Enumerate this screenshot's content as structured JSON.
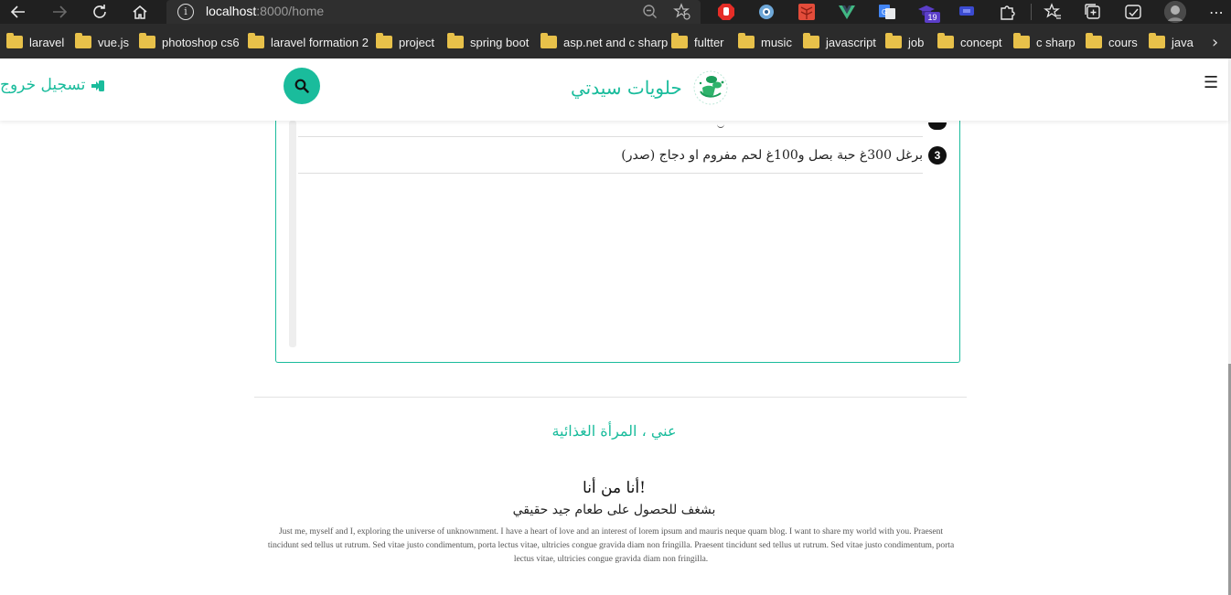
{
  "browser": {
    "url_host": "localhost",
    "url_path": ":8000/home",
    "extension_badge": "19",
    "bookmarks": [
      "laravel",
      "vue.js",
      "photoshop cs6",
      "laravel formation 2",
      "project",
      "spring boot",
      "asp.net and c sharp",
      "fultter",
      "music",
      "javascript",
      "job",
      "concept",
      "c sharp",
      "cours",
      "java"
    ]
  },
  "navbar": {
    "logout_label": "تسجيل خروج",
    "brand_name": "حلويات سيدتي"
  },
  "recipe": {
    "step_number": "3",
    "step_text": "برغل 300غ حبة بصل و100غ لحم مفروم او دجاج (صدر)"
  },
  "about": {
    "section_title": "عني ، المرأة الغذائية",
    "heading": "أنا من أنا!",
    "subheading": "بشغف للحصول على طعام جيد حقيقي",
    "body": "Just me, myself and I, exploring the universe of unknownment. I have a heart of love and an interest of lorem ipsum and mauris neque quam blog. I want to share my world with you. Praesent tincidunt sed tellus ut rutrum. Sed vitae justo condimentum, porta lectus vitae, ultricies congue gravida diam non fringilla. Praesent tincidunt sed tellus ut rutrum. Sed vitae justo condimentum, porta lectus vitae, ultricies congue gravida diam non fringilla."
  },
  "colors": {
    "accent": "#1abc9c",
    "chrome_dark": "#202020",
    "bookmarks_bar": "#2b2b2b"
  }
}
